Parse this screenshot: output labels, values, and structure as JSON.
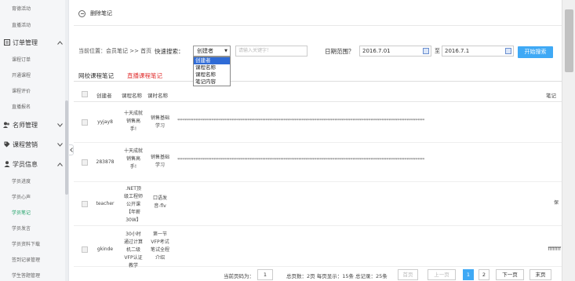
{
  "sidebar": {
    "top_items": [
      "育德活动",
      "直播活动"
    ],
    "groups": [
      {
        "name": "订单管理",
        "icon": "list-icon",
        "expanded": true,
        "items": [
          "课程订单",
          "开通课程",
          "课程评价",
          "直播报名"
        ]
      },
      {
        "name": "名师管理",
        "icon": "users-icon",
        "expanded": false,
        "items": []
      },
      {
        "name": "课程营销",
        "icon": "tag-icon",
        "expanded": false,
        "items": []
      },
      {
        "name": "学员信息",
        "icon": "user-icon",
        "expanded": true,
        "items": [
          "学员进度",
          "学员心声",
          "学员笔记",
          "学员发言",
          "学员资料下载",
          "签到记录管理",
          "学生答题管理"
        ]
      }
    ],
    "active_item": "学员笔记"
  },
  "toolbar": {
    "delete_label": "删除笔记"
  },
  "filters": {
    "breadcrumb": "当前位置：会员笔记 >> 首页",
    "quick_search_label": "快速搜索：",
    "search_by_value": "创建者",
    "search_by_options": [
      "创建者",
      "课程名称",
      "课程名称",
      "笔记内容"
    ],
    "search_by_highlighted": 0,
    "keyword_placeholder": "请输入关键字！",
    "date_range_label": "日期范围？",
    "date_from": "2016.7.01",
    "date_sep": "至",
    "date_to": "2016.7.1",
    "search_button": "开始搜索"
  },
  "tabs": [
    {
      "label": "网校课程笔记",
      "active": true
    },
    {
      "label": "直播课程笔记",
      "active": false
    }
  ],
  "table": {
    "headers": [
      "创建者",
      "课程名称",
      "课时名称",
      "笔记"
    ],
    "rows": [
      {
        "creator": "yyjay8",
        "course": "十天成就销售高手!",
        "lesson": "销售基础学习",
        "note": "*****************************************************************************************************************************************",
        "trailing": ""
      },
      {
        "creator": "283878",
        "course": "十天成就销售高手!",
        "lesson": "销售基础学习",
        "note": "*****************************************************************************************************************************************",
        "trailing": ""
      },
      {
        "creator": "teacher",
        "course": ".NET顶级工程师公开课【年薪30W】",
        "lesson": "口语发音-flv",
        "note": "",
        "trailing": "保"
      },
      {
        "creator": "gkinde",
        "course": "30小时通过计算机二级VFP认证教学",
        "lesson": "第一节VFP考试笔试全程介绍",
        "note": "",
        "trailing": "ffffffff"
      }
    ]
  },
  "pager": {
    "goto_label": "当前页码为：",
    "goto_value": "1",
    "summary": "总页数：2页  每页显示：15条  总记录：25条",
    "first": "首页",
    "prev": "上一页",
    "pages": [
      "1",
      "2"
    ],
    "current_page": "1",
    "next": "下一页",
    "last": "末页"
  },
  "colors": {
    "accent": "#3fa9f5",
    "active_green": "#23a36a",
    "live_tab_red": "#e03030",
    "dropdown_highlight": "#2f6bd6"
  }
}
